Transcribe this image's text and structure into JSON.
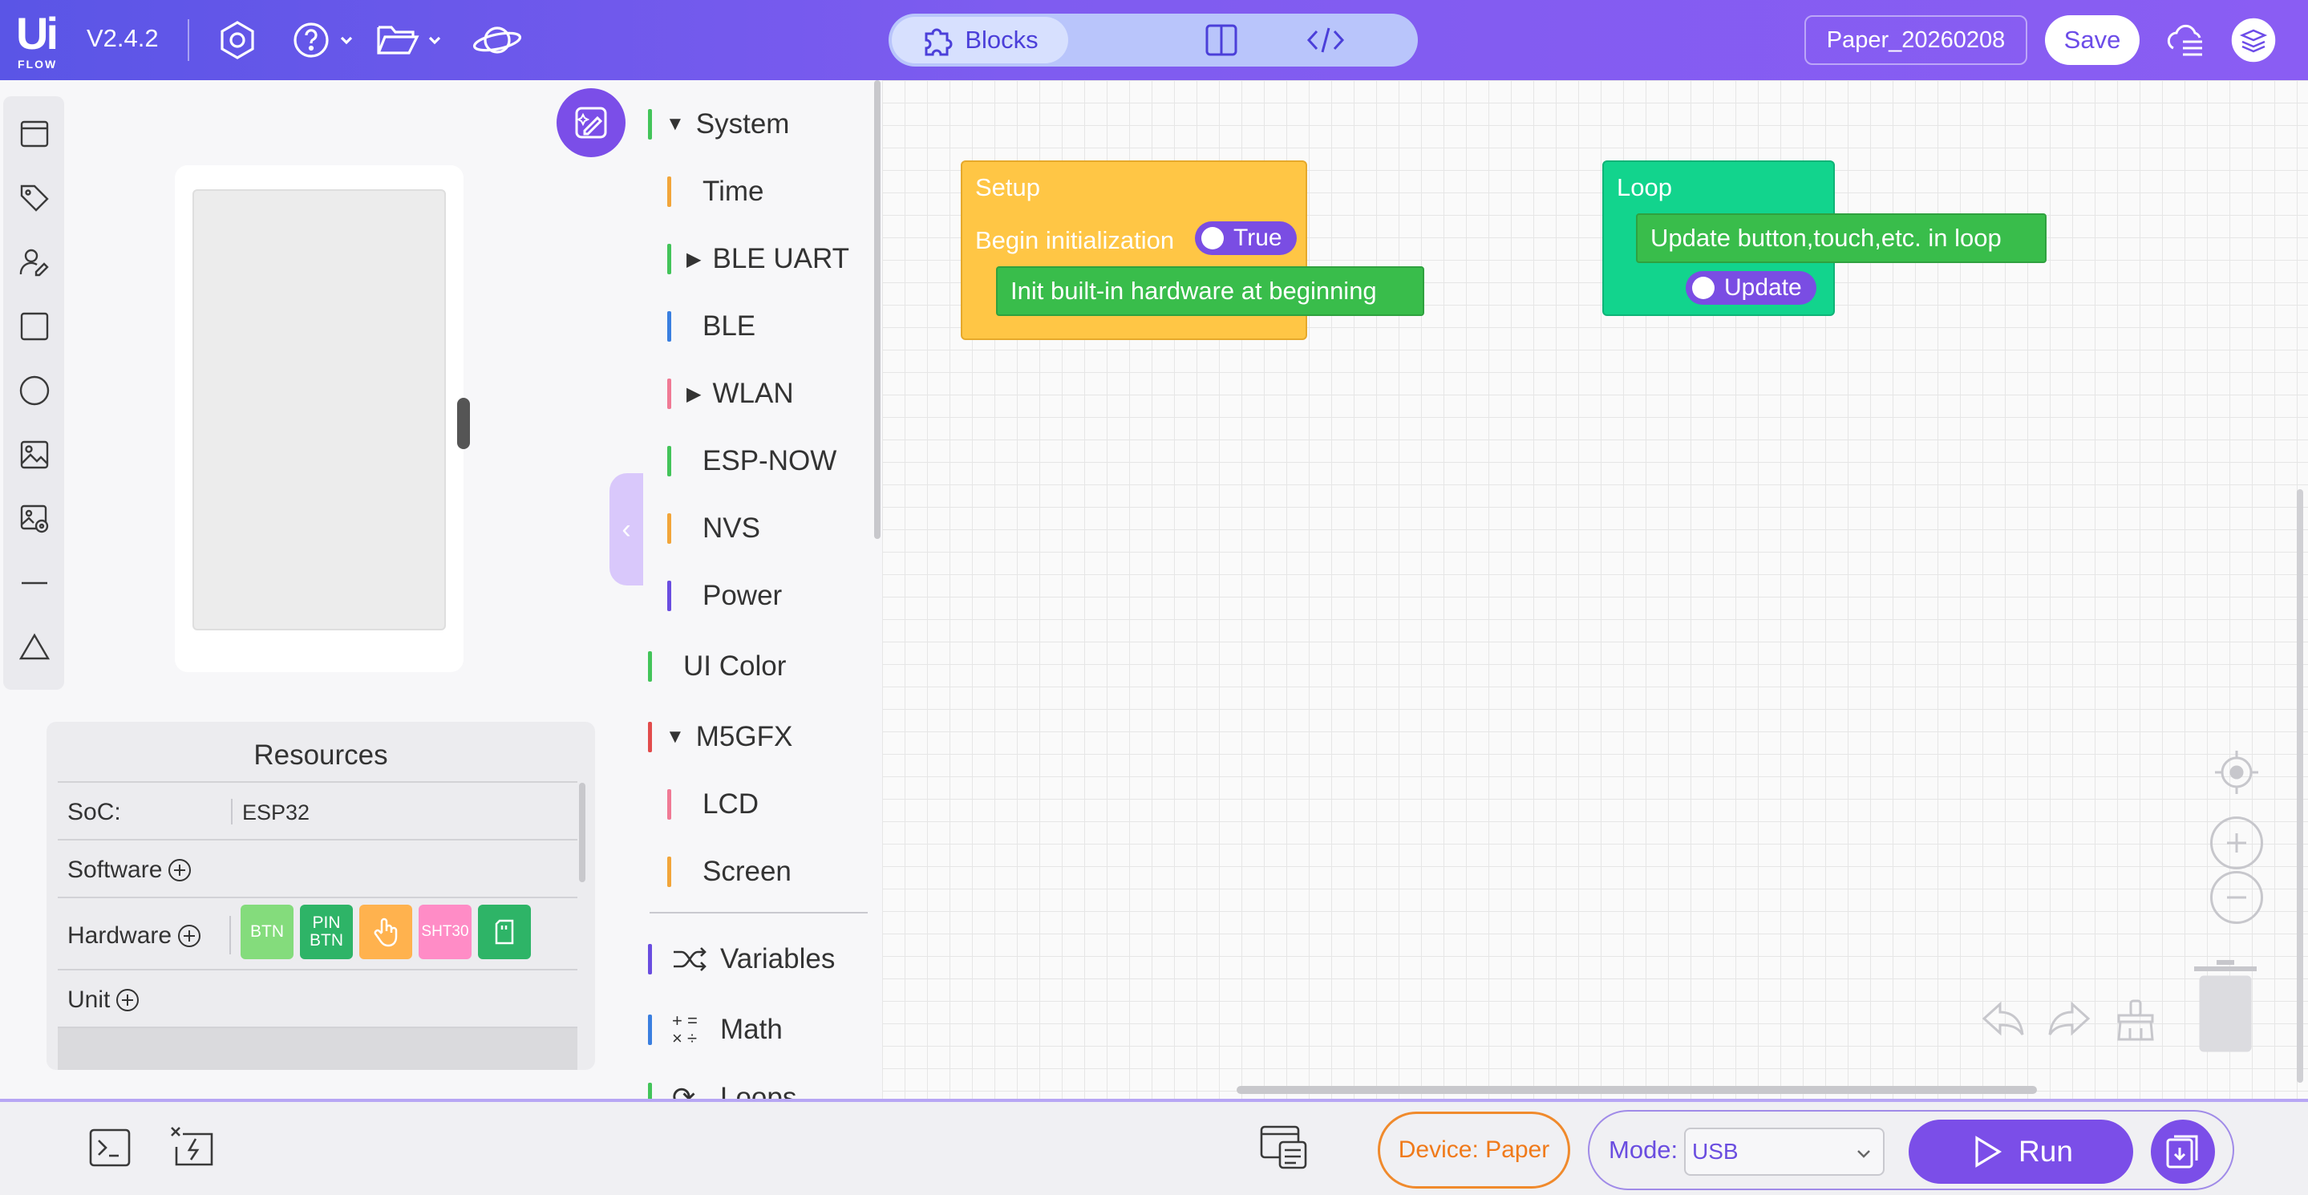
{
  "app": {
    "version": "V2.4.2",
    "logo_top": "Ui",
    "logo_bottom": "FLOW"
  },
  "header": {
    "mode_blocks_label": "Blocks",
    "project_name": "Paper_20260208",
    "save_label": "Save",
    "accent": "#7b4ee8"
  },
  "categories": {
    "system": "System",
    "time": "Time",
    "ble_uart": "BLE UART",
    "ble": "BLE",
    "wlan": "WLAN",
    "espnow": "ESP-NOW",
    "nvs": "NVS",
    "power": "Power",
    "ui_color": "UI Color",
    "m5gfx": "M5GFX",
    "lcd": "LCD",
    "screen": "Screen",
    "variables": "Variables",
    "math": "Math",
    "loops": "Loops"
  },
  "blocks": {
    "setup_title": "Setup",
    "setup_begin": "Begin initialization",
    "setup_toggle": "True",
    "setup_init": "Init built-in hardware at beginning",
    "loop_title": "Loop",
    "loop_update_stmt": "Update button,touch,etc. in loop",
    "loop_toggle": "Update"
  },
  "resources": {
    "title": "Resources",
    "soc_label": "SoC:",
    "soc_value": "ESP32",
    "software_label": "Software",
    "hardware_label": "Hardware",
    "unit_label": "Unit",
    "hw_chips": {
      "btn": "BTN",
      "pin_btn_1": "PIN",
      "pin_btn_2": "BTN",
      "sht30": "SHT30"
    }
  },
  "bottom": {
    "device_prefix": "Device:",
    "device_name": "Paper",
    "mode_label": "Mode:",
    "mode_value": "USB",
    "run_label": "Run"
  }
}
